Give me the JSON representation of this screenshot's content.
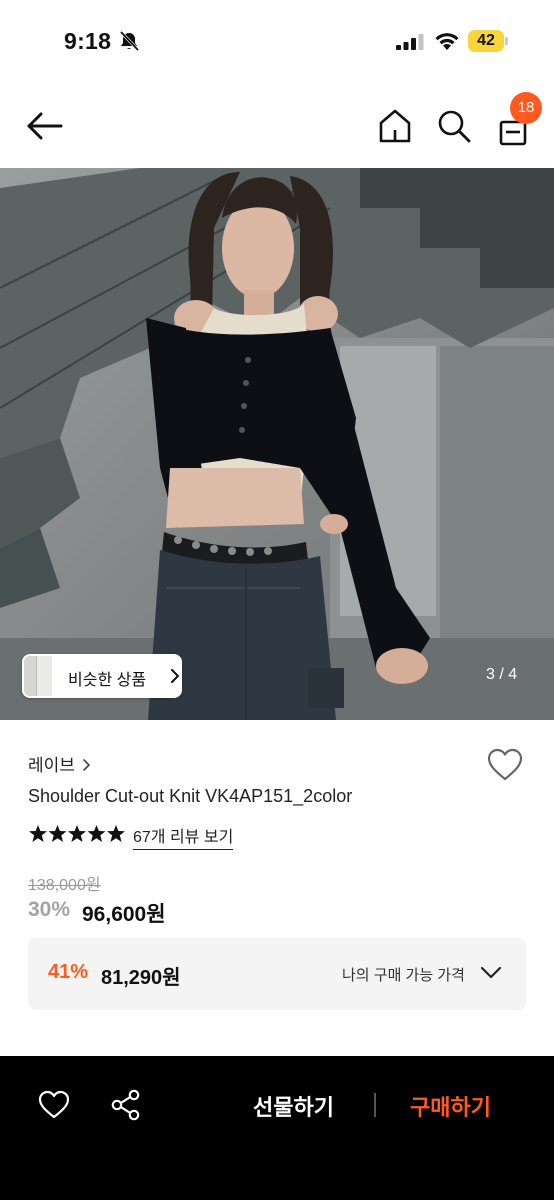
{
  "status_bar": {
    "time": "9:18",
    "battery": "42"
  },
  "header": {
    "cart_count": "18"
  },
  "hero": {
    "similar_label": "비슷한 상품",
    "page_indicator": "3 / 4"
  },
  "product": {
    "brand": "레이브",
    "name": "Shoulder Cut-out Knit VK4AP151_2color",
    "rating_stars": 5,
    "review_link": "67개 리뷰 보기",
    "original_price": "138,000원",
    "discount_rate": "30%",
    "sale_price": "96,600원"
  },
  "coupon": {
    "rate": "41%",
    "price": "81,290원",
    "label": "나의 구매 가능 가격"
  },
  "bottom_bar": {
    "gift_label": "선물하기",
    "buy_label": "구매하기"
  },
  "colors": {
    "accent": "#ff5a1f",
    "battery": "#f7d53b",
    "bottom_bar": "#000000"
  }
}
